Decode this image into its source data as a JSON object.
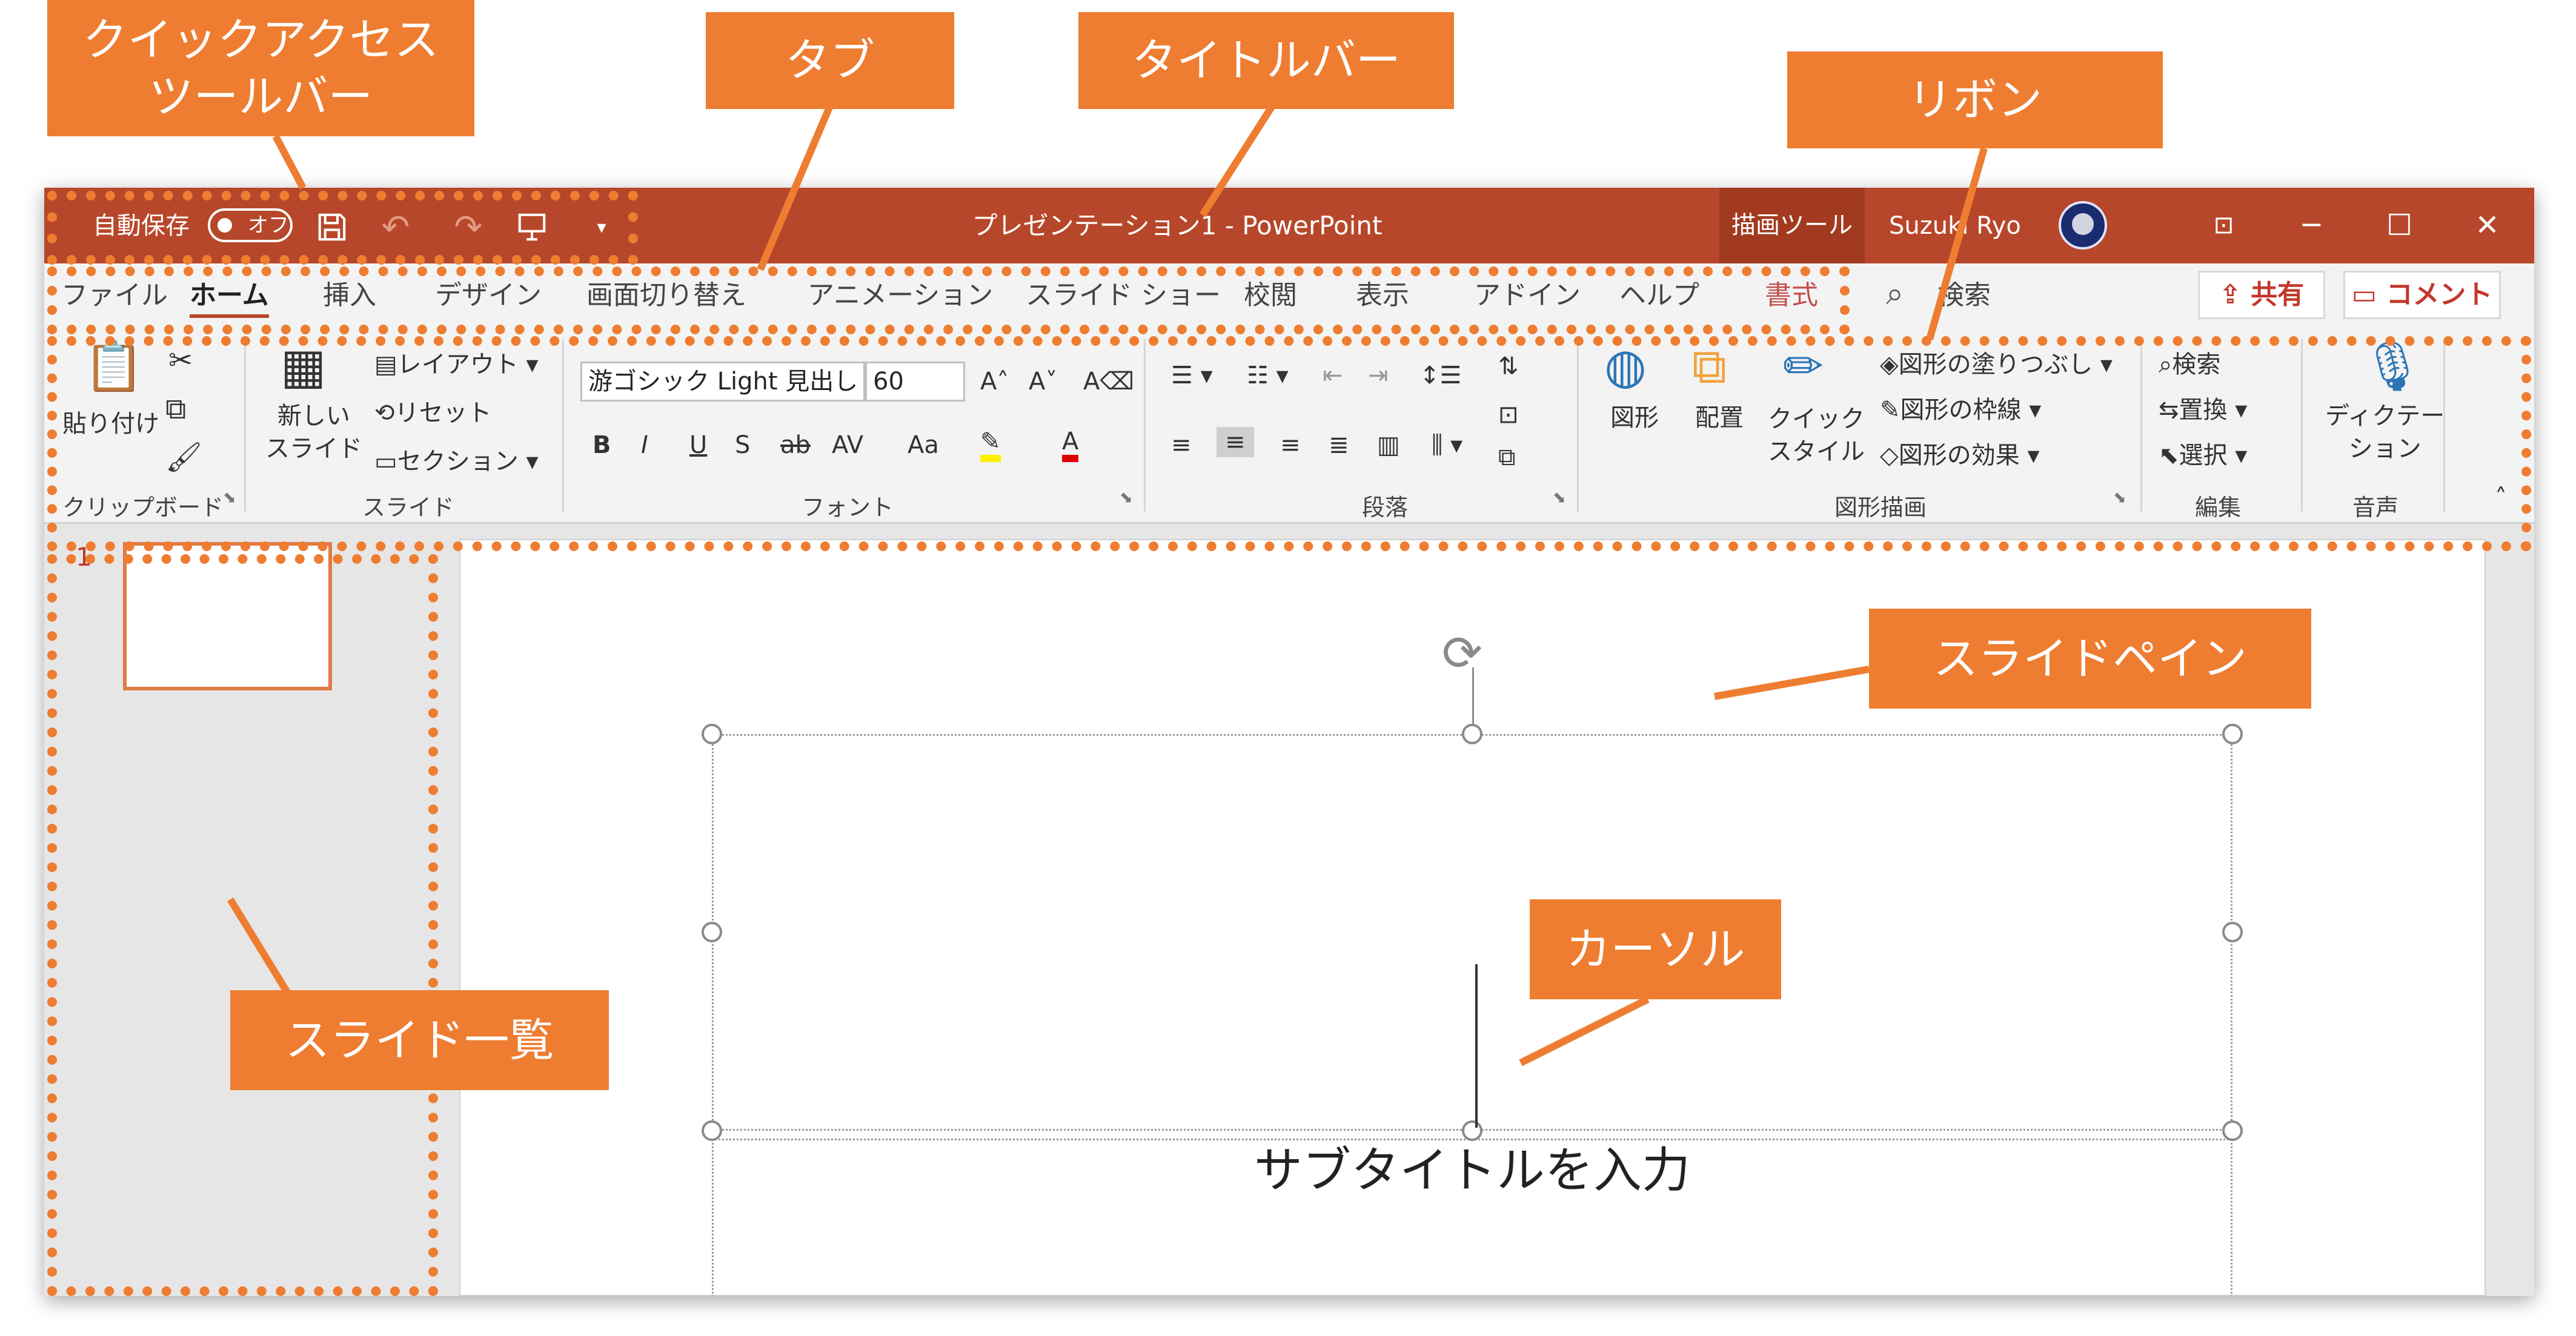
{
  "annotations": {
    "quick_access": "クイックアクセス\nツールバー",
    "tabs": "タブ",
    "title_bar": "タイトルバー",
    "ribbon": "リボン",
    "slide_pane": "スライドペイン",
    "cursor": "カーソル",
    "slide_list": "スライド一覧"
  },
  "title_bar": {
    "autosave": "自動保存",
    "autosave_state": "オフ",
    "document_title": "プレゼンテーション1  -  PowerPoint",
    "context_tab": "描画ツール",
    "user": "Suzuki Ryo",
    "icons": [
      "save-icon",
      "undo-icon",
      "redo-icon",
      "present-icon",
      "customize-icon"
    ]
  },
  "tabs": [
    "ファイル",
    "ホーム",
    "挿入",
    "デザイン",
    "画面切り替え",
    "アニメーション",
    "スライド ショー",
    "校閲",
    "表示",
    "アドイン",
    "ヘルプ",
    "書式"
  ],
  "active_tab": "ホーム",
  "tell_me": "検索",
  "share_button": "共有",
  "comment_button": "コメント",
  "ribbon": {
    "clipboard": {
      "paste": "貼り付け",
      "label": "クリップボード"
    },
    "slides": {
      "new_slide": "新しい\nスライド",
      "layout": "レイアウト",
      "reset": "リセット",
      "section": "セクション",
      "label": "スライド"
    },
    "font": {
      "font_name": "游ゴシック Light 見出し",
      "font_size": "60",
      "label": "フォント",
      "buttons": [
        "B",
        "I",
        "U",
        "S",
        "ab",
        "AV",
        "Aa"
      ]
    },
    "paragraph": {
      "label": "段落"
    },
    "drawing": {
      "shapes": "図形",
      "arrange": "配置",
      "quick_styles": "クイック\nスタイル",
      "fill": "図形の塗りつぶし",
      "outline": "図形の枠線",
      "effects": "図形の効果",
      "label": "図形描画"
    },
    "editing": {
      "find": "検索",
      "replace": "置換",
      "select": "選択",
      "label": "編集"
    },
    "voice": {
      "dictate": "ディクテー\nション",
      "label": "音声"
    }
  },
  "thumbnail": {
    "number": "1"
  },
  "slide": {
    "subtitle_placeholder": "サブタイトルを入力"
  },
  "colors": {
    "accent": "#b7472a",
    "annotation": "#ee7d31"
  }
}
